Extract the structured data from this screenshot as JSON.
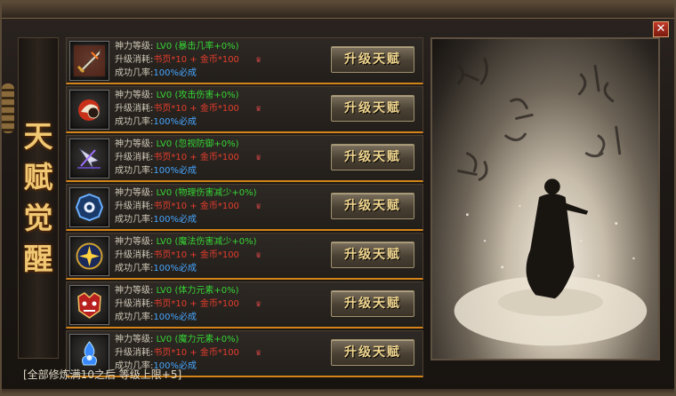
{
  "title": [
    "天",
    "赋",
    "觉",
    "醒"
  ],
  "close_label": "✕",
  "labels": {
    "level": "神力等级:",
    "cost": "升级消耗:",
    "rate": "成功几率:",
    "button": "升级天赋",
    "level_value": "LV0",
    "cost_value": "书页*10 + 金币*100",
    "coin_glyph": "♛",
    "rate_value": "100%必成"
  },
  "talents": [
    {
      "icon": "sword-icon",
      "attr": "(暴击几率+0%)"
    },
    {
      "icon": "fist-strike-icon",
      "attr": "(攻击伤害+0%)"
    },
    {
      "icon": "arrow-piercing-icon",
      "attr": "(忽视防御+0%)"
    },
    {
      "icon": "bagua-shield-icon",
      "attr": "(物理伤害减少+0%)"
    },
    {
      "icon": "magic-star-icon",
      "attr": "(魔法伤害减少+0%)"
    },
    {
      "icon": "beast-mask-icon",
      "attr": "(体力元素+0%)"
    },
    {
      "icon": "mana-flame-icon",
      "attr": "(魔力元素+0%)"
    }
  ],
  "footer": "[全部修炼满10之后  等级上限+5]"
}
